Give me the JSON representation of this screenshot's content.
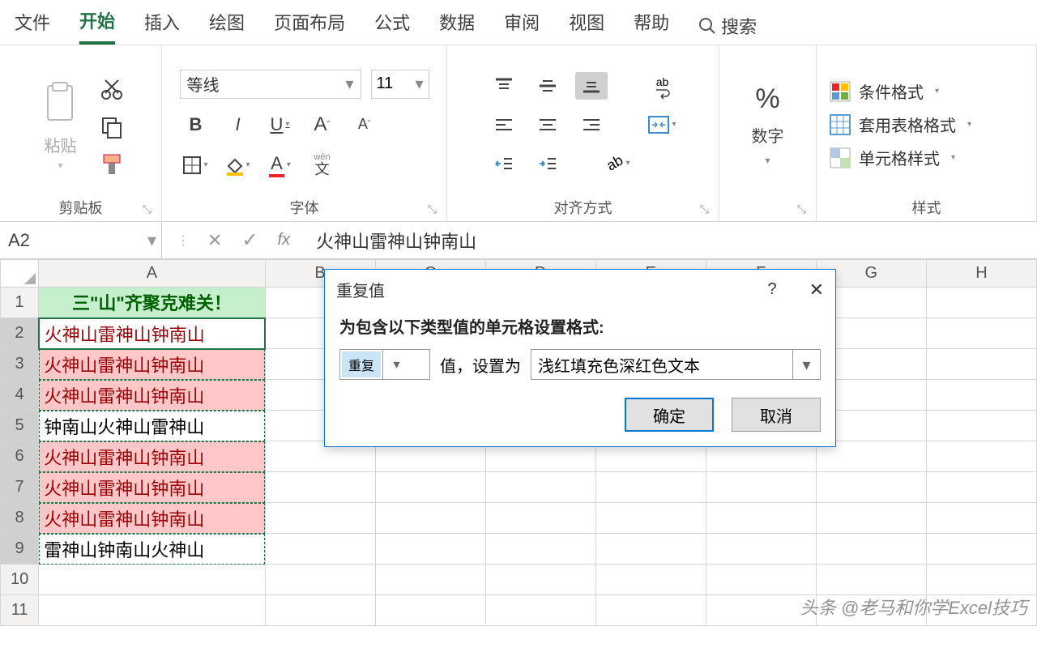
{
  "tabs": {
    "file": "文件",
    "home": "开始",
    "insert": "插入",
    "draw": "绘图",
    "layout": "页面布局",
    "formula": "公式",
    "data": "数据",
    "review": "审阅",
    "view": "视图",
    "help": "帮助",
    "search": "搜索"
  },
  "ribbon": {
    "clipboard": {
      "paste": "粘贴",
      "label": "剪贴板"
    },
    "font": {
      "name": "等线",
      "size": "11",
      "bold": "B",
      "italic": "I",
      "underline": "U",
      "grow": "Aˆ",
      "shrink": "Aˇ",
      "phonetic": "wén",
      "label": "字体"
    },
    "align": {
      "label": "对齐方式",
      "wrap": "ab"
    },
    "number": {
      "sign": "%",
      "label": "数字"
    },
    "styles": {
      "cond": "条件格式",
      "table": "套用表格格式",
      "cell": "单元格样式",
      "label": "样式"
    }
  },
  "fbar": {
    "name": "A2",
    "formula": "火神山雷神山钟南山",
    "fx": "fx"
  },
  "cols": [
    "A",
    "B",
    "C",
    "D",
    "E",
    "F",
    "G",
    "H"
  ],
  "rows": [
    {
      "n": "1",
      "v": "三\"山\"齐聚克难关！",
      "cls": "hdr-cell"
    },
    {
      "n": "2",
      "v": "火神山雷神山钟南山",
      "cls": "dup active-cell"
    },
    {
      "n": "3",
      "v": "火神山雷神山钟南山",
      "cls": "dup"
    },
    {
      "n": "4",
      "v": "火神山雷神山钟南山",
      "cls": "dup"
    },
    {
      "n": "5",
      "v": "钟南山火神山雷神山",
      "cls": ""
    },
    {
      "n": "6",
      "v": "火神山雷神山钟南山",
      "cls": "dup"
    },
    {
      "n": "7",
      "v": "火神山雷神山钟南山",
      "cls": "dup"
    },
    {
      "n": "8",
      "v": "火神山雷神山钟南山",
      "cls": "dup"
    },
    {
      "n": "9",
      "v": "雷神山钟南山火神山",
      "cls": ""
    },
    {
      "n": "10",
      "v": "",
      "cls": ""
    },
    {
      "n": "11",
      "v": "",
      "cls": ""
    }
  ],
  "dialog": {
    "title": "重复值",
    "desc": "为包含以下类型值的单元格设置格式:",
    "type": "重复",
    "mid": "值，设置为",
    "fmt": "浅红填充色深红色文本",
    "ok": "确定",
    "cancel": "取消"
  },
  "watermark": "头条 @老马和你学Excel技巧"
}
